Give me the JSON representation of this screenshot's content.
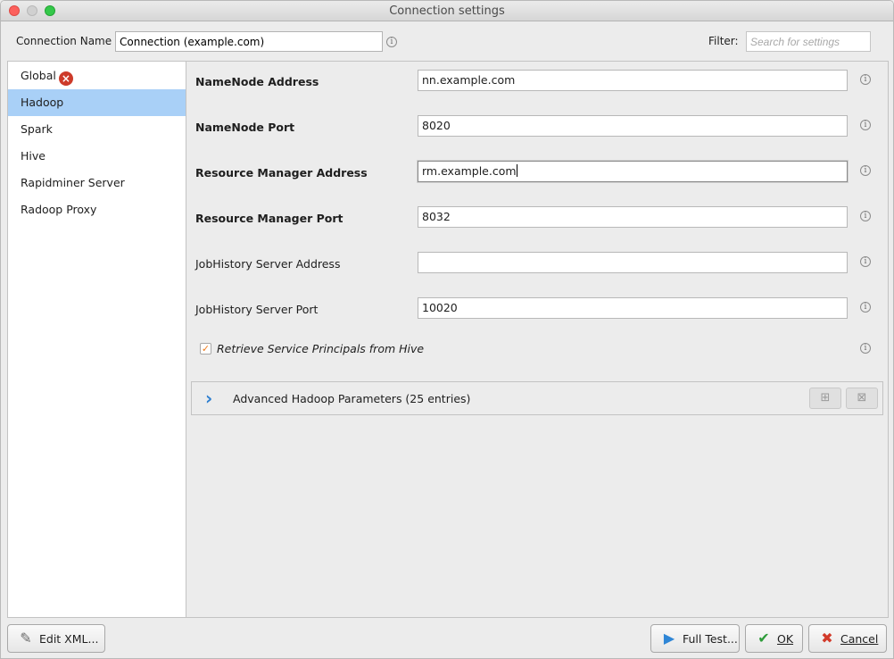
{
  "window": {
    "title": "Connection settings"
  },
  "header": {
    "connection_name_label": "Connection Name",
    "connection_name_value": "Connection (example.com)",
    "filter_label": "Filter:",
    "filter_placeholder": "Search for settings"
  },
  "sidebar": {
    "items": [
      {
        "label": "Global",
        "has_error": true
      },
      {
        "label": "Hadoop",
        "selected": true
      },
      {
        "label": "Spark"
      },
      {
        "label": "Hive"
      },
      {
        "label": "Rapidminer Server"
      },
      {
        "label": "Radoop Proxy"
      }
    ]
  },
  "fields": [
    {
      "label": "NameNode Address",
      "value": "nn.example.com",
      "bold": true
    },
    {
      "label": "NameNode Port",
      "value": "8020",
      "bold": true
    },
    {
      "label": "Resource Manager Address",
      "value": "rm.example.com",
      "bold": true,
      "focused": true
    },
    {
      "label": "Resource Manager Port",
      "value": "8032",
      "bold": true
    },
    {
      "label": "JobHistory Server Address",
      "value": "",
      "bold": false
    },
    {
      "label": "JobHistory Server Port",
      "value": "10020",
      "bold": false
    }
  ],
  "checkbox": {
    "label": "Retrieve Service Principals from Hive",
    "checked": true
  },
  "advanced": {
    "label": "Advanced Hadoop Parameters (25 entries)"
  },
  "buttons": {
    "edit_xml": "Edit XML...",
    "full_test": "Full Test...",
    "ok": "OK",
    "cancel": "Cancel"
  },
  "colors": {
    "selection": "#a9d0f7",
    "error": "#cd3b2a",
    "ok_green": "#2e9c3a",
    "cancel_red": "#d23a2a",
    "checkmark_orange": "#ee7b1c"
  }
}
